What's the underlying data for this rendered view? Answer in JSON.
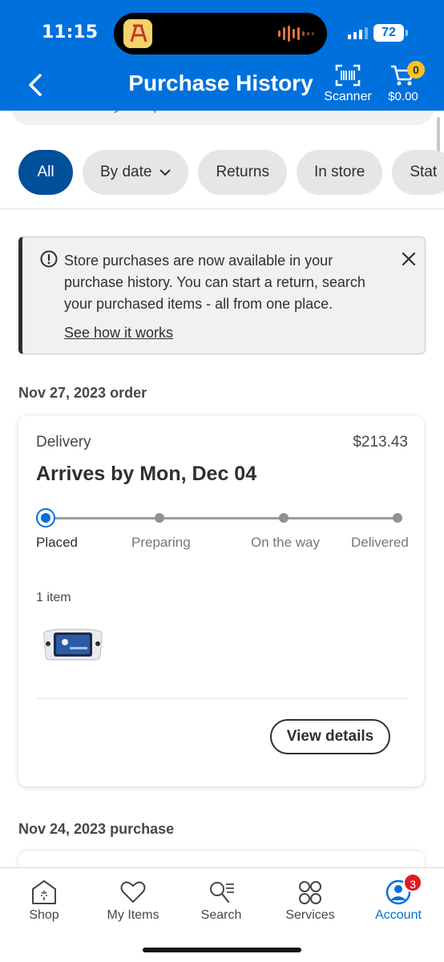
{
  "status_bar": {
    "time": "11:15",
    "battery": "72"
  },
  "header": {
    "title": "Purchase History",
    "scanner_label": "Scanner",
    "cart_total": "$0.00",
    "cart_count": "0"
  },
  "search": {
    "placeholder": "Search your purchases"
  },
  "filters": [
    {
      "label": "All",
      "active": true
    },
    {
      "label": "By date",
      "active": false
    },
    {
      "label": "Returns",
      "active": false
    },
    {
      "label": "In store",
      "active": false
    },
    {
      "label": "Stat",
      "active": false
    }
  ],
  "banner": {
    "message": "Store purchases are now available in your purchase history. You can start a return, search your purchased items - all from one place.",
    "link": "See how it works"
  },
  "orders": [
    {
      "date_label": "Nov 27, 2023 order",
      "type": "Delivery",
      "total": "$213.43",
      "arrival": "Arrives by Mon, Dec 04",
      "steps": [
        "Placed",
        "Preparing",
        "On the way",
        "Delivered"
      ],
      "current_step": 0,
      "item_count": "1 item",
      "button": "View details"
    },
    {
      "date_label": "Nov 24, 2023 purchase"
    }
  ],
  "tabbar": [
    {
      "label": "Shop",
      "icon": "shop-icon"
    },
    {
      "label": "My Items",
      "icon": "heart-icon"
    },
    {
      "label": "Search",
      "icon": "search-list-icon"
    },
    {
      "label": "Services",
      "icon": "services-icon"
    },
    {
      "label": "Account",
      "icon": "account-icon",
      "badge": "3",
      "active": true
    }
  ],
  "colors": {
    "brand_blue": "#0071dc",
    "active_chip": "#004f9a",
    "cart_badge": "#ffc220",
    "alert_badge": "#de1c24"
  }
}
